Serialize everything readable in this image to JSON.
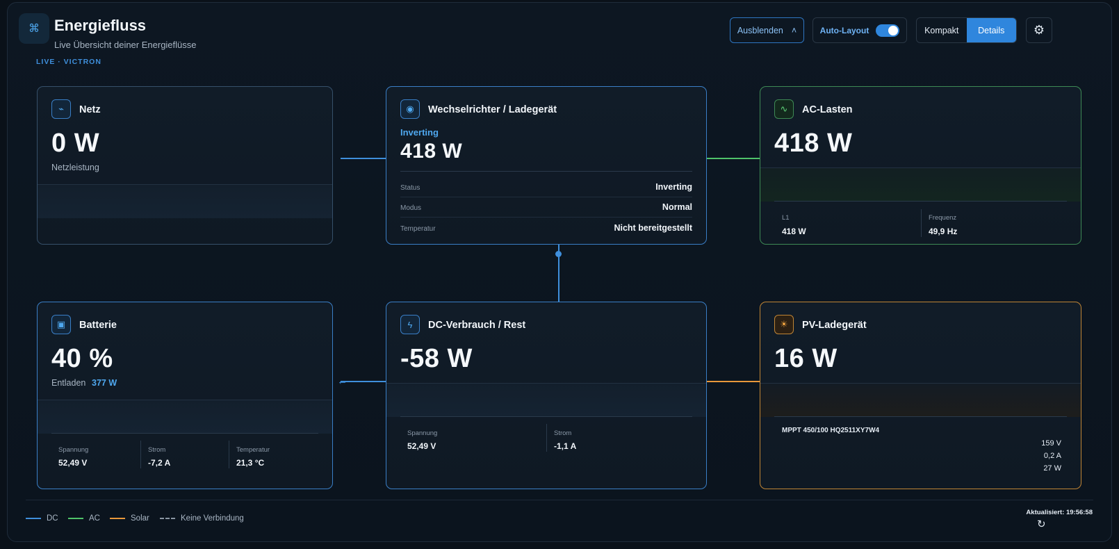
{
  "header": {
    "title": "Energiefluss",
    "subtitle": "Live Übersicht deiner Energieflüsse",
    "live_label": "LIVE · VICTRON",
    "app_icon": "⌘"
  },
  "toolbar": {
    "hide_label": "Ausblenden",
    "hide_chevron": "˄",
    "auto_layout_label": "Auto-Layout",
    "auto_layout_on": true,
    "view_compact": "Kompakt",
    "view_details": "Details",
    "view_selected": "Details",
    "settings_icon": "⚙"
  },
  "cards": {
    "grid": {
      "title": "Netz",
      "icon": "⌁",
      "value": "0 W",
      "sub": "Netzleistung"
    },
    "inverter": {
      "title": "Wechselrichter / Ladegerät",
      "icon": "◉",
      "state": "Inverting",
      "value": "418 W",
      "rows": [
        {
          "k": "Status",
          "v": "Inverting"
        },
        {
          "k": "Modus",
          "v": "Normal"
        },
        {
          "k": "Temperatur",
          "v": "Nicht bereitgestellt"
        }
      ]
    },
    "ac": {
      "title": "AC-Lasten",
      "icon": "∿",
      "value": "418 W",
      "cells": [
        {
          "k": "L1",
          "v": "418 W"
        },
        {
          "k": "Frequenz",
          "v": "49,9 Hz"
        }
      ]
    },
    "battery": {
      "title": "Batterie",
      "icon": "▣",
      "value": "40 %",
      "state": "Entladen",
      "power": "377 W",
      "cells": [
        {
          "k": "Spannung",
          "v": "52,49 V"
        },
        {
          "k": "Strom",
          "v": "-7,2 A"
        },
        {
          "k": "Temperatur",
          "v": "21,3 °C"
        }
      ]
    },
    "dc": {
      "title": "DC-Verbrauch / Rest",
      "icon": "ϟ",
      "value": "-58 W",
      "cells": [
        {
          "k": "Spannung",
          "v": "52,49 V"
        },
        {
          "k": "Strom",
          "v": "-1,1 A"
        }
      ]
    },
    "pv": {
      "title": "PV-Ladegerät",
      "icon": "☀",
      "value": "16 W",
      "device": "MPPT 450/100 HQ2511XY7W4",
      "values": [
        "159 V",
        "0,2 A",
        "27 W"
      ]
    }
  },
  "legend": [
    {
      "label": "DC",
      "color": "#3f8fdc",
      "style": "solid"
    },
    {
      "label": "AC",
      "color": "#4fc36a",
      "style": "solid"
    },
    {
      "label": "Solar",
      "color": "#e9983a",
      "style": "solid"
    },
    {
      "label": "Keine Verbindung",
      "color": "#8a96a3",
      "style": "dashed"
    }
  ],
  "footer": {
    "updated_label": "Aktualisiert: 19:56:58",
    "refresh_icon": "↻"
  }
}
